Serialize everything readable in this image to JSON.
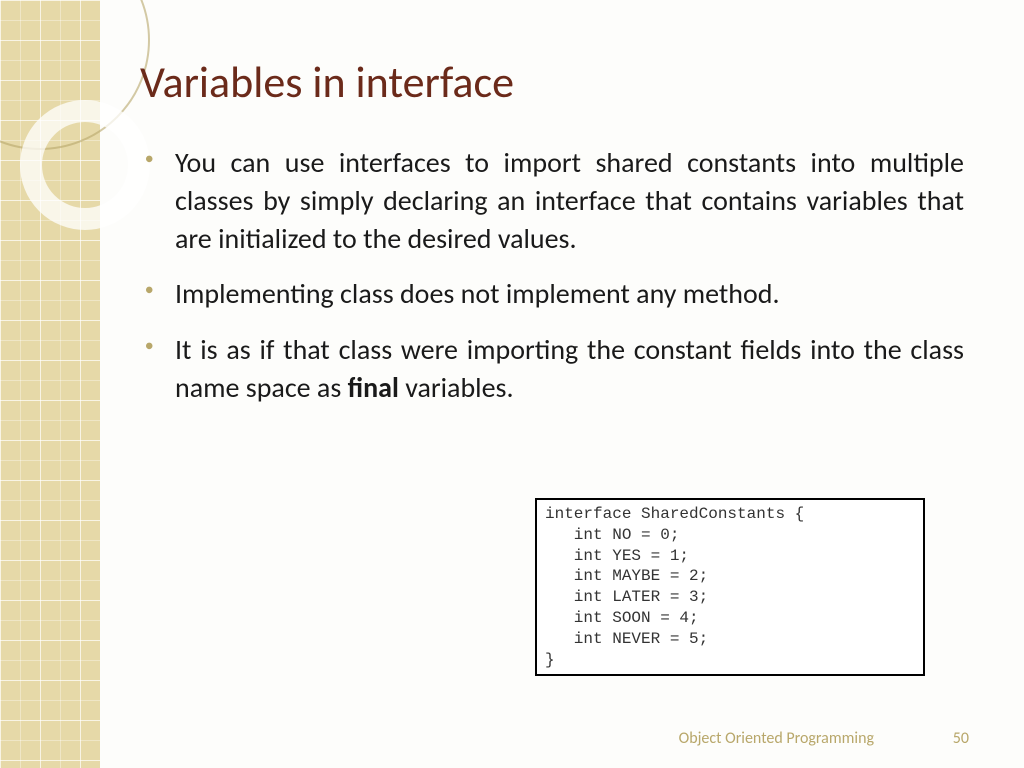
{
  "title": "Variables in interface",
  "bullets": [
    "You can use interfaces to import shared constants into multiple classes by simply declaring an interface that contains variables that are initialized to the desired values.",
    "Implementing class does not implement any method.",
    "It is as if that class were importing the constant fields into the class name space as "
  ],
  "bold_word": "final",
  "bullet3_tail": " variables.",
  "code": "interface SharedConstants {\n   int NO = 0;\n   int YES = 1;\n   int MAYBE = 2;\n   int LATER = 3;\n   int SOON = 4;\n   int NEVER = 5;\n}",
  "footer": "Object Oriented Programming",
  "page": "50"
}
